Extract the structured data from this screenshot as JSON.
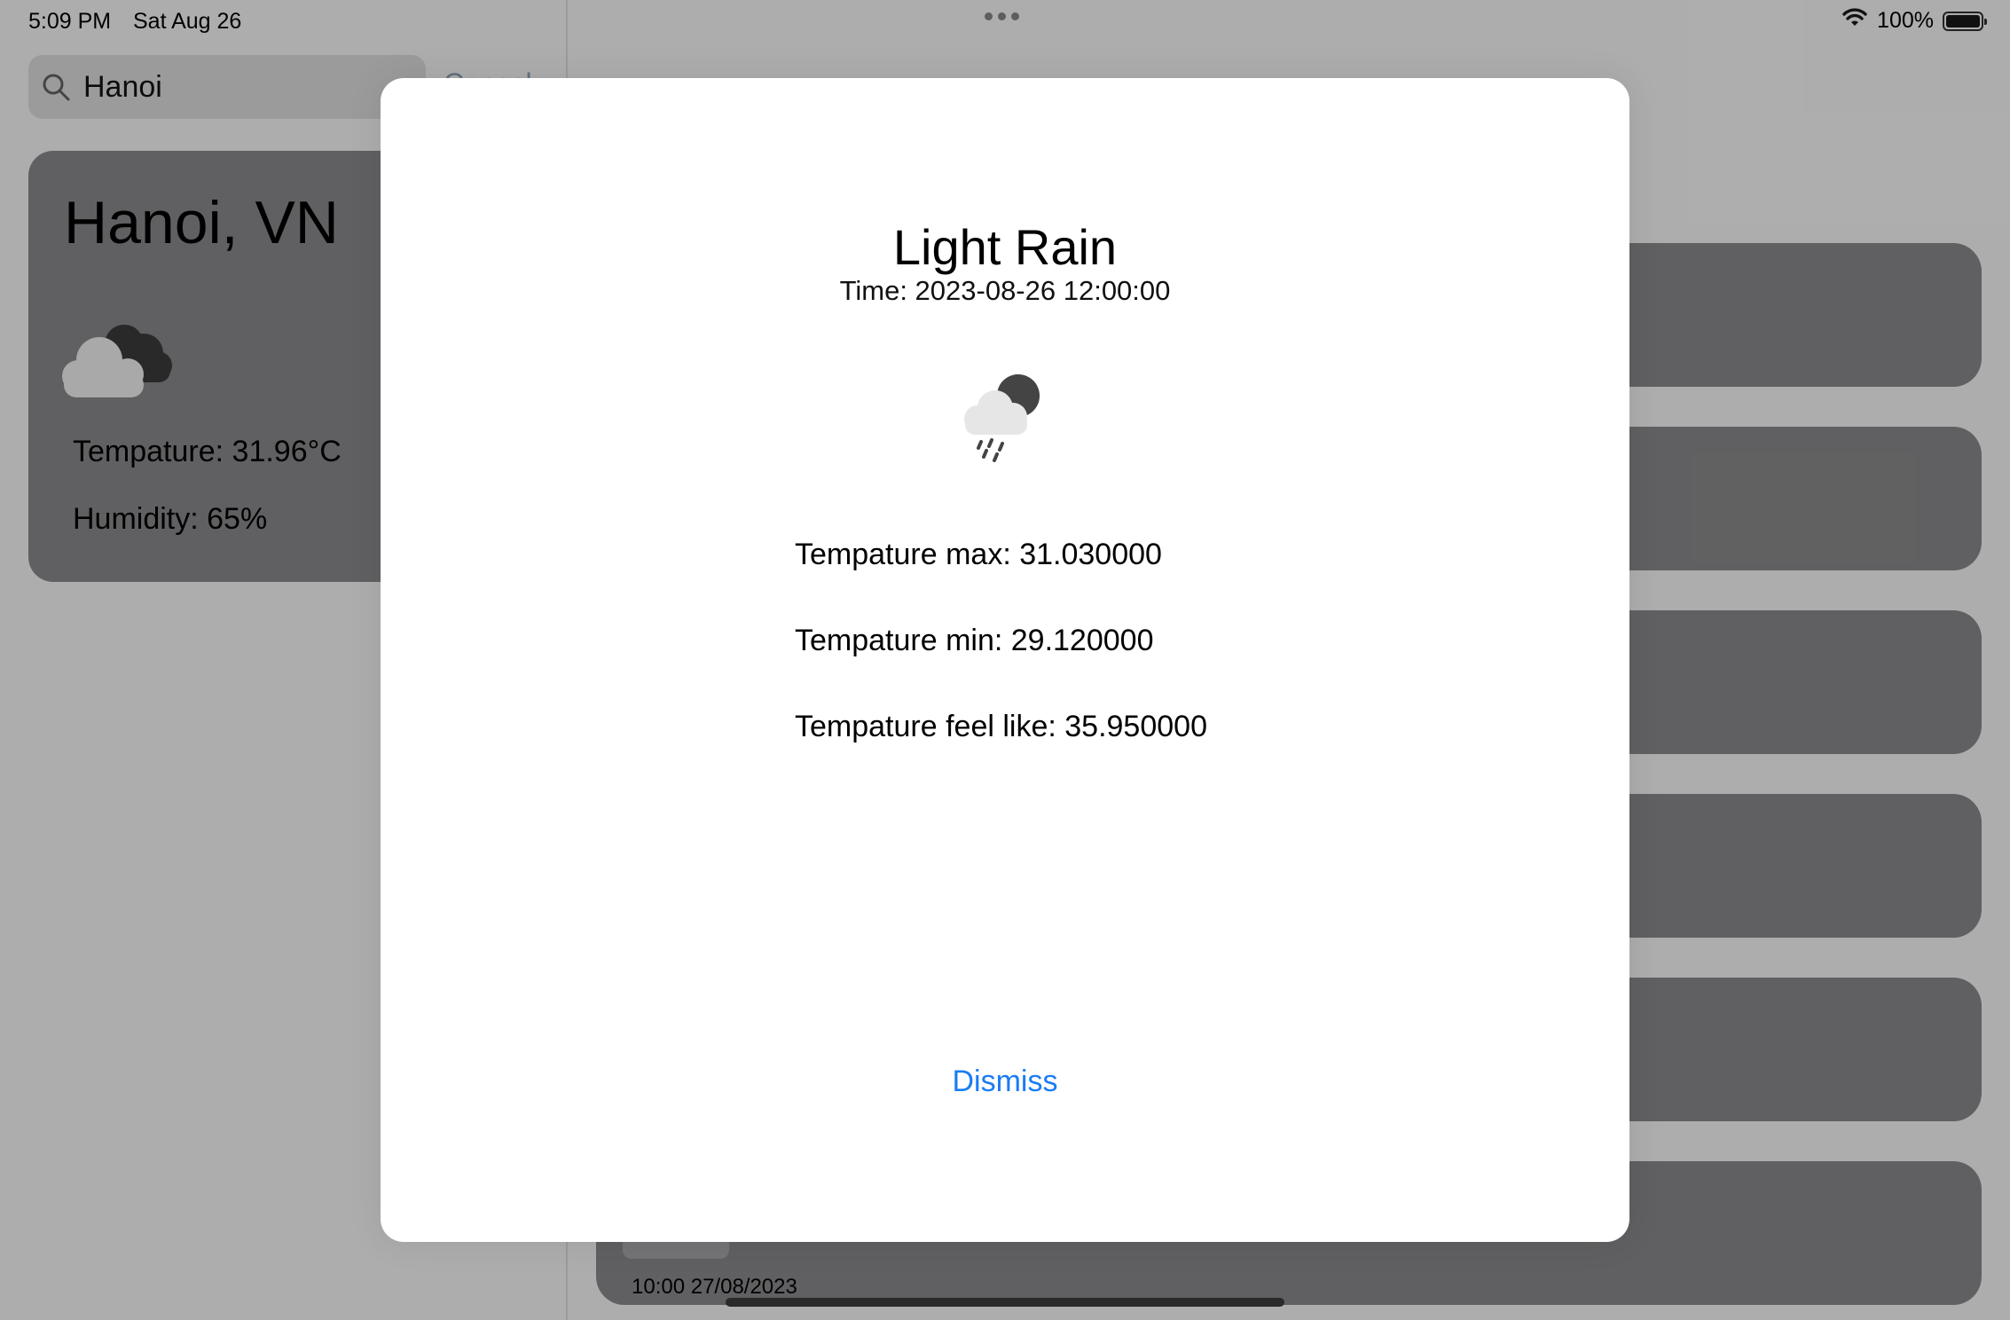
{
  "status_bar": {
    "time": "5:09 PM",
    "date": "Sat Aug 26",
    "battery_percent": "100%",
    "wifi_icon": "wifi-icon",
    "battery_icon": "battery-icon",
    "battery_level": 1.0
  },
  "sidebar": {
    "search": {
      "value": "Hanoi",
      "icon": "search-icon"
    },
    "city_card": {
      "name": "Hanoi, VN",
      "icon": "cloudy-icon",
      "temperature": "Tempature: 31.96°C",
      "humidity": "Humidity: 65%"
    }
  },
  "main": {
    "forecast_cards": [
      {
        "humidity": "",
        "time": ""
      },
      {
        "humidity": "",
        "time": ""
      },
      {
        "humidity": "",
        "time": ""
      },
      {
        "humidity": "",
        "time": ""
      },
      {
        "humidity": "",
        "time": ""
      },
      {
        "humidity": "",
        "time": "10:00 27/08/2023"
      }
    ]
  },
  "modal": {
    "title": "Light Rain",
    "time": "Time: 2023-08-26 12:00:00",
    "icon": "light-rain-night-icon",
    "temp_max": "Tempature max: 31.030000",
    "temp_min": "Tempature min: 29.120000",
    "temp_feel": "Tempature feel like: 35.950000",
    "dismiss_label": "Dismiss"
  },
  "colors": {
    "accent": "#1a7cf5",
    "card": "#767678",
    "background": "#d3d4d3"
  }
}
